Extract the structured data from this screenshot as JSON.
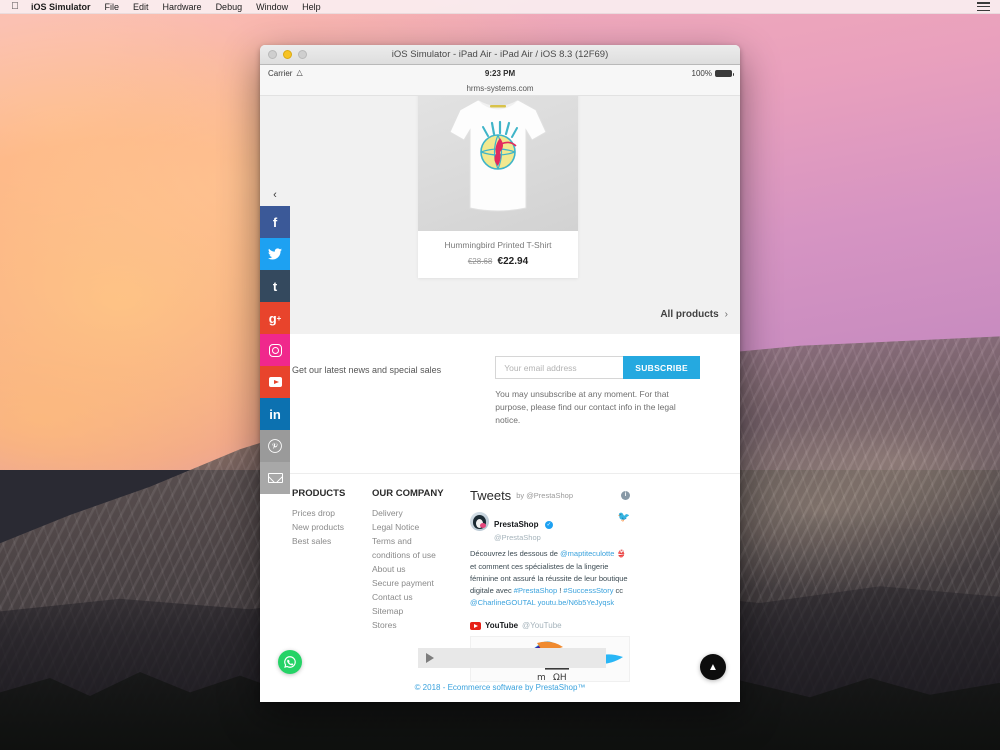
{
  "menubar": {
    "apple_icon": "apple-icon",
    "items": [
      {
        "label": "iOS Simulator",
        "bold": true
      },
      {
        "label": "File"
      },
      {
        "label": "Edit"
      },
      {
        "label": "Hardware"
      },
      {
        "label": "Debug"
      },
      {
        "label": "Window"
      },
      {
        "label": "Help"
      }
    ],
    "right_icon": "list-icon"
  },
  "window": {
    "title": "iOS Simulator - iPad Air - iPad Air / iOS 8.3 (12F69)"
  },
  "ios_status": {
    "carrier": "Carrier",
    "wifi_icon": "wifi-icon",
    "time": "9:23 PM",
    "battery_percent": "100%"
  },
  "browser": {
    "url": "hrms-systems.com"
  },
  "featured": {
    "product": {
      "name": "Hummingbird Printed T-Shirt",
      "price_old": "€28.68",
      "price_new": "€22.94"
    },
    "all_products_label": "All products",
    "all_products_chevron": "›"
  },
  "newsletter": {
    "text": "Get our latest news and special sales",
    "email_placeholder": "Your email address",
    "email_value": "",
    "subscribe_label": "SUBSCRIBE",
    "note": "You may unsubscribe at any moment. For that purpose, please find our contact info in the legal notice.",
    "accent_color": "#25a9e0"
  },
  "footer": {
    "columns": [
      {
        "title": "PRODUCTS",
        "links": [
          "Prices drop",
          "New products",
          "Best sales"
        ]
      },
      {
        "title": "OUR COMPANY",
        "links": [
          "Delivery",
          "Legal Notice",
          "Terms and conditions of use",
          "About us",
          "Secure payment",
          "Contact us",
          "Sitemap",
          "Stores"
        ]
      }
    ],
    "copyright": "© 2018 - Ecommerce software by PrestaShop™"
  },
  "twitter_widget": {
    "heading": "Tweets",
    "by": "by @PrestaShop",
    "info_icon": "info-icon",
    "account_name": "PrestaShop",
    "verified_mark": "✓",
    "account_handle": "@PrestaShop",
    "bird_icon": "twitter-bird-icon",
    "tweet_segments": [
      {
        "text": "Découvrez les dessous de ",
        "link": false
      },
      {
        "text": "@maptiteculotte",
        "link": true
      },
      {
        "text": " 👙 et comment ces spécialistes de la lingerie féminine ont assuré la réussite de leur boutique digitale avec ",
        "link": false
      },
      {
        "text": "#PrestaShop",
        "link": true
      },
      {
        "text": " ! ",
        "link": false
      },
      {
        "text": "#SuccessStory",
        "link": true
      },
      {
        "text": " cc ",
        "link": false
      },
      {
        "text": "@CharlineGOUTAL",
        "link": true
      },
      {
        "text": " ",
        "link": false
      },
      {
        "text": "youtu.be/N6b5YeJyqsk",
        "link": true
      }
    ]
  },
  "youtube_card": {
    "logo_icon": "youtube-icon",
    "name": "YouTube",
    "handle": "@YouTube",
    "play_icon": "play-icon"
  },
  "share_bar": {
    "toggle_icon": "chevron-left-icon",
    "buttons": [
      {
        "name": "facebook",
        "glyph": "f",
        "color": "#3b5998"
      },
      {
        "name": "twitter",
        "glyph": "🐦",
        "color": "#1da1f2"
      },
      {
        "name": "tumblr",
        "glyph": "t",
        "color": "#34495e"
      },
      {
        "name": "googleplus",
        "glyph": "g+",
        "color": "#e8442c"
      },
      {
        "name": "instagram",
        "glyph": "",
        "color": "#f0288c"
      },
      {
        "name": "youtube",
        "glyph": "",
        "color": "#e8442c"
      },
      {
        "name": "linkedin",
        "glyph": "in",
        "color": "#0c71b0"
      },
      {
        "name": "pinterest",
        "glyph": "Ⓟ",
        "color": "#9a9a9a"
      },
      {
        "name": "email",
        "glyph": "",
        "color": "#a8a8a8"
      }
    ]
  },
  "fab": {
    "whatsapp_icon": "whatsapp-icon",
    "scroll_top_icon": "chevron-up-icon"
  }
}
